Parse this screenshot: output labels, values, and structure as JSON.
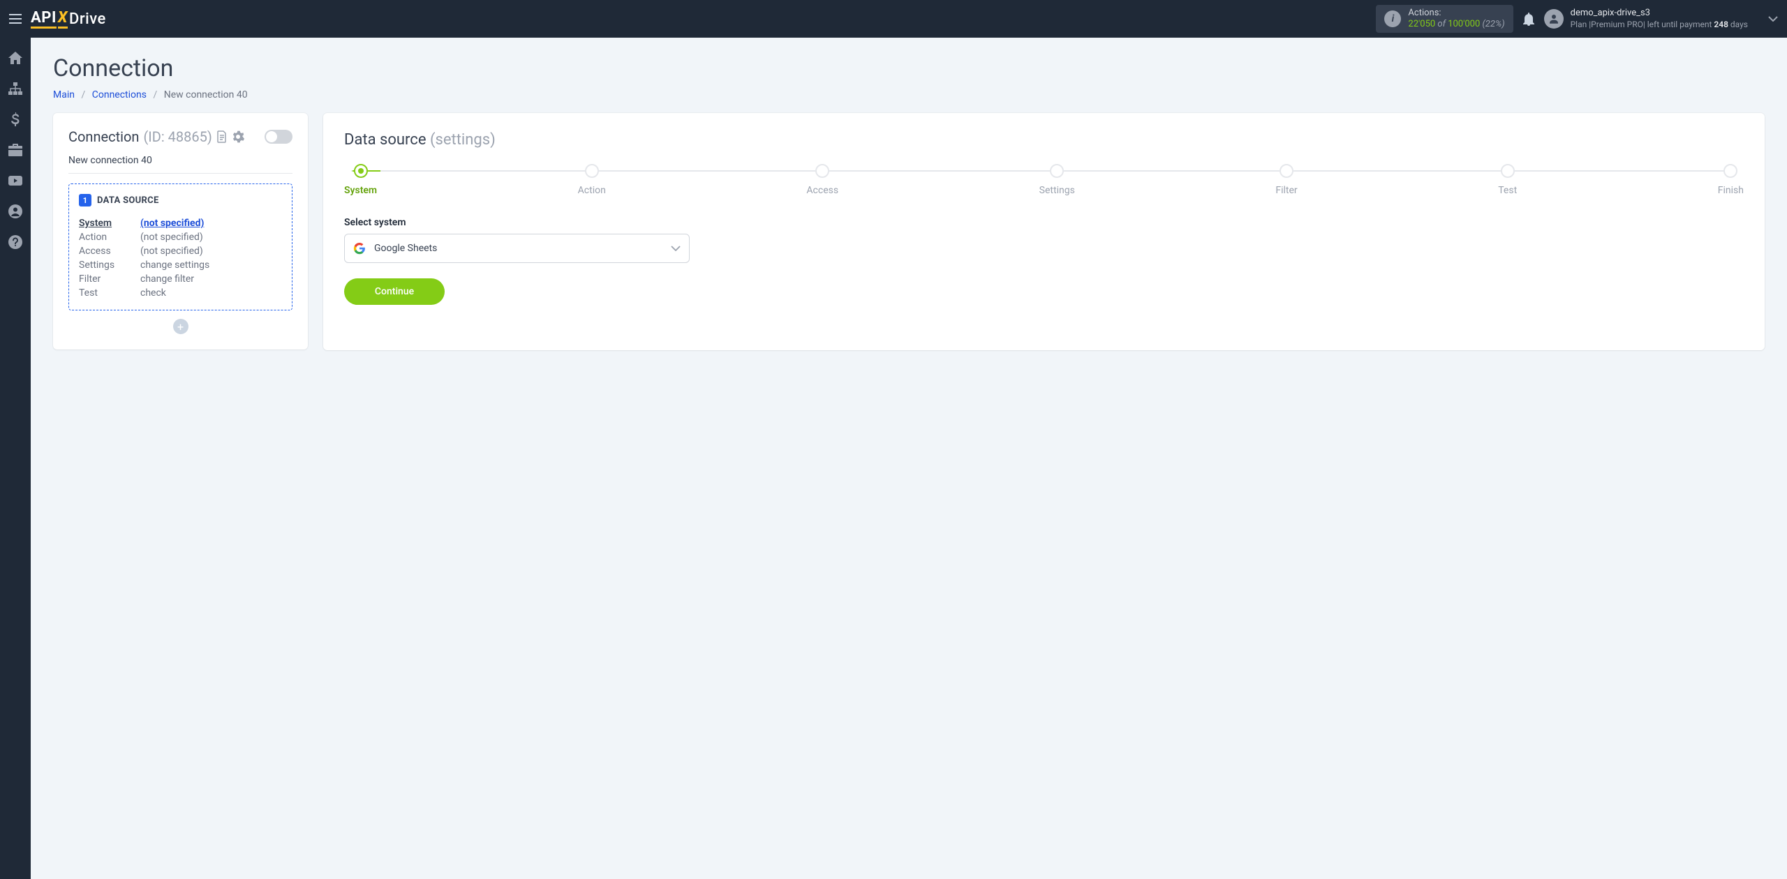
{
  "header": {
    "brand_api": "API",
    "brand_x": "X",
    "brand_drive": "Drive",
    "actions_label": "Actions:",
    "actions_used": "22'050",
    "actions_of": " of ",
    "actions_total": "100'000",
    "actions_pct": " (22%)",
    "user_name": "demo_apix-drive_s3",
    "user_plan_prefix": "Plan |",
    "user_plan_name": "Premium PRO",
    "user_plan_mid": "| left until payment ",
    "user_plan_days": "248",
    "user_plan_suffix": " days"
  },
  "page": {
    "title": "Connection",
    "crumb_main": "Main",
    "crumb_connections": "Connections",
    "crumb_current": "New connection 40"
  },
  "left": {
    "head_label": "Connection",
    "head_id": "(ID: 48865)",
    "name": "New connection 40",
    "ds_number": "1",
    "ds_title": "DATA SOURCE",
    "rows": [
      {
        "k": "System",
        "v": "(not specified)",
        "active": true
      },
      {
        "k": "Action",
        "v": "(not specified)",
        "active": false
      },
      {
        "k": "Access",
        "v": "(not specified)",
        "active": false
      },
      {
        "k": "Settings",
        "v": "change settings",
        "active": false
      },
      {
        "k": "Filter",
        "v": "change filter",
        "active": false
      },
      {
        "k": "Test",
        "v": "check",
        "active": false
      }
    ]
  },
  "right": {
    "title_main": "Data source ",
    "title_muted": "(settings)",
    "steps": [
      "System",
      "Action",
      "Access",
      "Settings",
      "Filter",
      "Test",
      "Finish"
    ],
    "form_label": "Select system",
    "select_value": "Google Sheets",
    "continue": "Continue"
  }
}
